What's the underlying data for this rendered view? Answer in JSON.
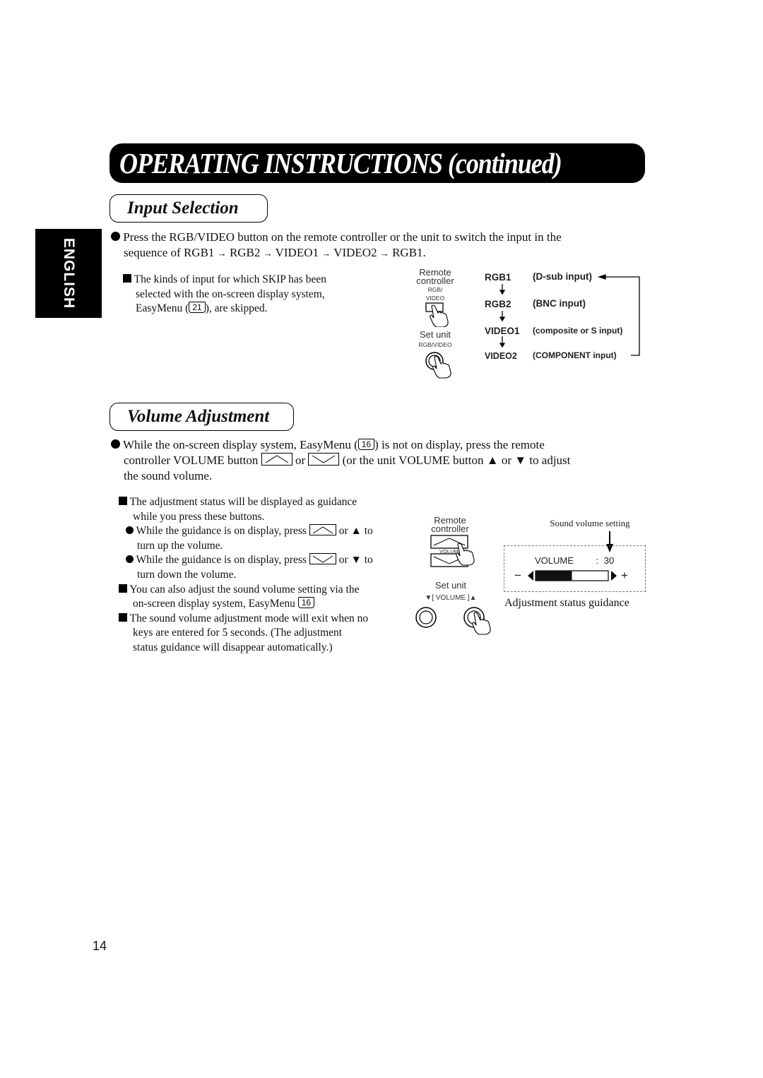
{
  "header": {
    "title": "OPERATING INSTRUCTIONS",
    "title_suffix": "(continued)"
  },
  "language_tab": "ENGLISH",
  "input_selection": {
    "heading": "Input Selection",
    "main_bullet": {
      "line1": "Press the RGB/VIDEO button on the remote controller or the unit to switch the input in the",
      "line2_prefix": "sequence of ",
      "sequence": [
        "RGB1",
        "RGB2",
        "VIDEO1",
        "VIDEO2",
        "RGB1."
      ],
      "arrow": "→"
    },
    "note": {
      "line1": "The kinds of input for which SKIP has been",
      "line2": "selected with the on-screen display system,",
      "line3_prefix": "EasyMenu (",
      "ref_page": "21",
      "line3_suffix": "), are skipped."
    },
    "diagram": {
      "remote_label_1": "Remote",
      "remote_label_2": "controller",
      "remote_button_1": "RGB/",
      "remote_button_2": "VIDEO",
      "unit_label": "Set unit",
      "unit_button": "RGB/VIDEO",
      "sequence": [
        {
          "name": "RGB1",
          "desc": "(D-sub input)"
        },
        {
          "name": "RGB2",
          "desc": "(BNC input)"
        },
        {
          "name": "VIDEO1",
          "desc": "(composite or S input)"
        },
        {
          "name": "VIDEO2",
          "desc": "(COMPONENT input)"
        }
      ]
    }
  },
  "volume_adjustment": {
    "heading": "Volume Adjustment",
    "main_bullet": {
      "line1_prefix": "While the on-screen display system, EasyMenu (",
      "ref_page": "16",
      "line1_suffix": ") is not on display, press the remote",
      "line2_prefix": "controller VOLUME button",
      "line2_or": "or",
      "line2_suffix": "(or the unit VOLUME button ▲ or ▼ to adjust",
      "line3": "the sound volume."
    },
    "notes": [
      {
        "line1": "The adjustment status will be displayed as guidance",
        "line2": "while you press these buttons."
      }
    ],
    "sub_bullets": [
      {
        "prefix": "While the guidance is on display, press",
        "suffix": "or ▲ to",
        "line2": "turn up the volume."
      },
      {
        "prefix": "While the guidance is on display, press",
        "suffix": "or ▼ to",
        "line2": "turn down the volume."
      }
    ],
    "note2": {
      "line1": "You can also adjust the sound volume setting via the",
      "line2_prefix": "on-screen display system, EasyMenu",
      "ref_page": "16"
    },
    "note3": {
      "line1": "The sound volume adjustment mode will exit when no",
      "line2": "keys are entered for 5 seconds.  (The adjustment",
      "line3": "status guidance will disappear automatically.)"
    },
    "diagram": {
      "remote_label_1": "Remote",
      "remote_label_2": "controller",
      "remote_button": "VOLUME",
      "unit_label": "Set unit",
      "unit_buttons": "▼[ VOLUME ]▲"
    },
    "guidance": {
      "setting_label": "Sound volume setting",
      "volume_label": "VOLUME",
      "separator": ":",
      "volume_value": "30",
      "volume_fraction": 0.5,
      "minus": "−",
      "plus": "+",
      "caption": "Adjustment status guidance"
    }
  },
  "page_number": "14"
}
